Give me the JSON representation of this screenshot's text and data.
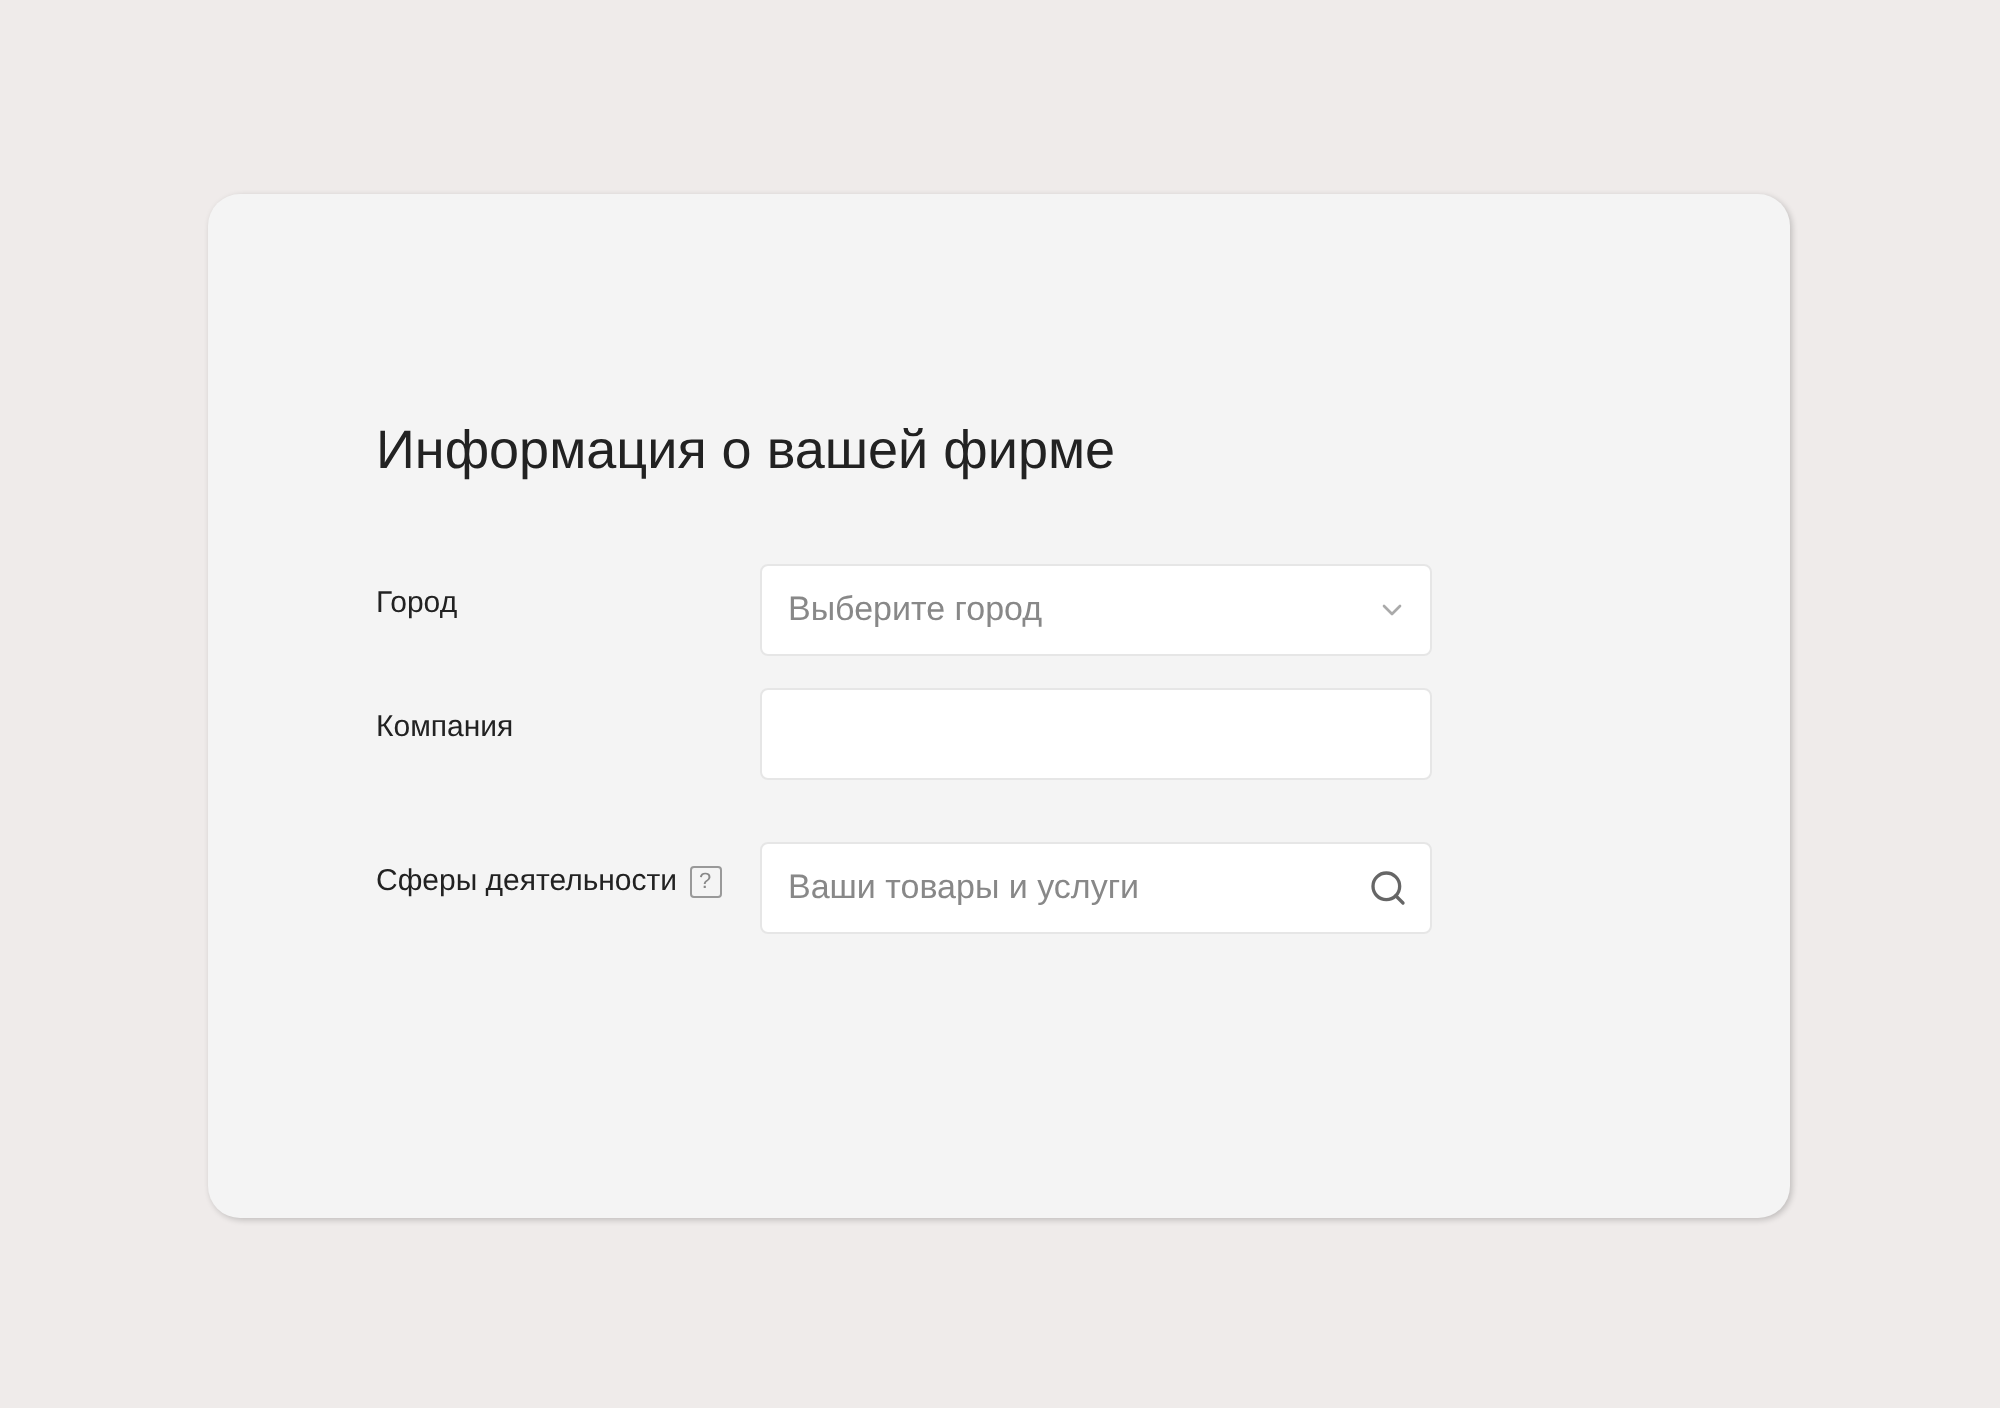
{
  "title": "Информация о вашей фирме",
  "fields": [
    {
      "label": "Город",
      "kind": "select",
      "placeholder": "Выберите город"
    },
    {
      "label": "Компания",
      "kind": "text"
    },
    {
      "label": "Сферы деятельности",
      "help": "?",
      "kind": "search",
      "placeholder": "Ваши товары и услуги"
    }
  ]
}
